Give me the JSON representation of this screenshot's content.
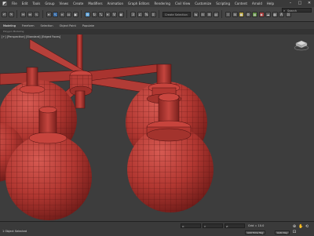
{
  "menubar": {
    "items": [
      "File",
      "Edit",
      "Tools",
      "Group",
      "Views",
      "Create",
      "Modifiers",
      "Animation",
      "Graph Editors",
      "Rendering",
      "Civil View",
      "Customize",
      "Scripting",
      "Content",
      "Arnold",
      "Help"
    ]
  },
  "toolbar": {
    "selection_set": "Create Selection Set",
    "workspace_label": "Workspaces",
    "search_label": "Search"
  },
  "ribbon": {
    "tabs": [
      "Modeling",
      "Freeform",
      "Selection",
      "Object Paint",
      "Populate"
    ],
    "sub_label": "Polygon Modeling"
  },
  "viewport": {
    "label": "[+] [Perspective] [Standard] [Edged Faces]",
    "mesh_color": "#b83a35",
    "wire_color": "#5a1412",
    "background": "#3d3d3d"
  },
  "status": {
    "selection_text": "1 Object Selected",
    "hint": "Click or click-and-drag to select objects",
    "x_label": "X:",
    "y_label": "Y:",
    "z_label": "Z:",
    "grid": "Grid = 10.0",
    "add_time_tag": "Add Time Tag",
    "auto_key": "Auto Key",
    "set_key": "Set Key",
    "selected": "Selected"
  }
}
